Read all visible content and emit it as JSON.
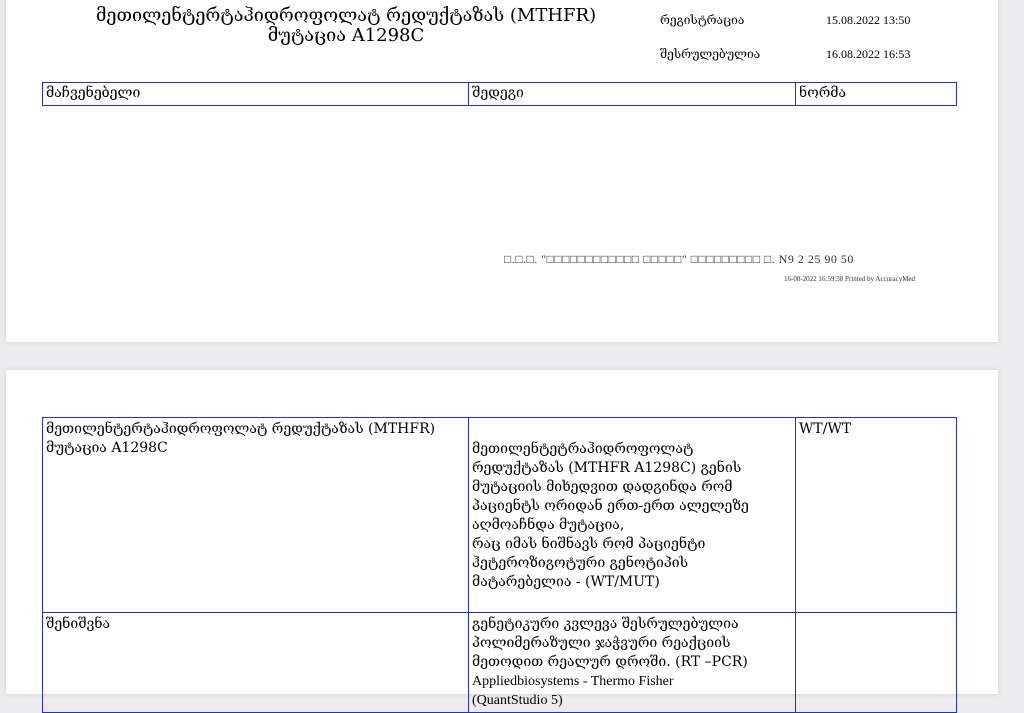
{
  "header": {
    "title_line1": "მეთილენტერტაჰიდროფოლატ რედუქტაზას (MTHFR)",
    "title_line2": "მუტაცია A1298C",
    "registration_label": "რეგისტრაცია",
    "registration_value": "15.08.2022 13:50",
    "completed_label": "შესრულებულია",
    "completed_value": "16.08.2022 16:53"
  },
  "columns": {
    "indicator": "მაჩვენებელი",
    "result": "შედეგი",
    "norm": "ნორმა"
  },
  "footer": {
    "company": "□.□.□. \"□□□□□□□□□□□□ □□□□□\" □□□□□□□□□ □. N9 2 25 90 50",
    "printed": "16-08-2022 16:59:38 Printed by AccuracyMed"
  },
  "results": [
    {
      "indicator": "მეთილენტერტაჰიდროფოლატ რედუქტაზას (MTHFR) მუტაცია A1298C",
      "result_lines": [
        "მეთილენტეტრაჰიდროფოლატ",
        "რედუქტაზას (MTHFR A1298C) გენის",
        "მუტაციის მიხედვით დადგინდა რომ",
        "პაციენტს ორიდან ერთ-ერთ ალელეზე",
        "აღმოაჩნდა მუტაცია,",
        "რაც იმას  ნიშნავს რომ  პაციენტი",
        "ჰეტეროზიგოტური გენოტიპის",
        "მატარებელია -  (WT/MUT)"
      ],
      "norm": "WT/WT"
    },
    {
      "indicator": "შენიშვნა",
      "result_lines": [
        "გენეტიკური კვლევა შესრულებულია",
        "პოლიმერაზული ჯაჭვური რეაქციის",
        "მეთოდით რეალურ დროში. (RT –PCR)",
        "Appliedbiosystems  -  Thermo Fisher",
        "(QuantStudio 5)"
      ],
      "norm": ""
    }
  ]
}
